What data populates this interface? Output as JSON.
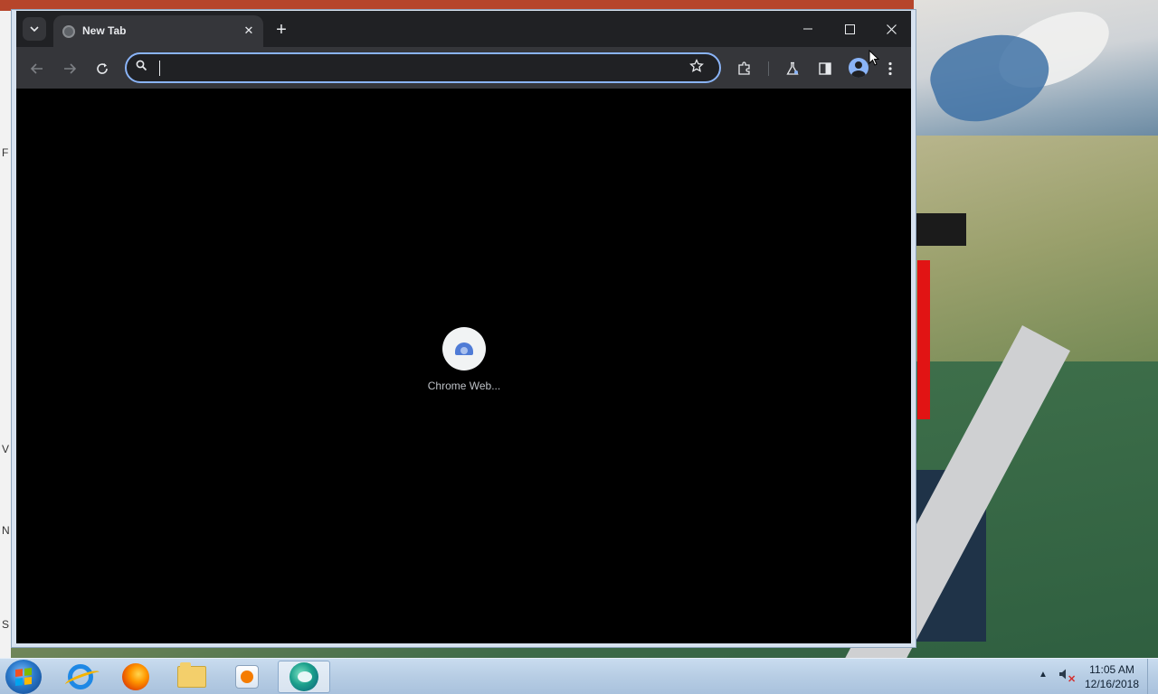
{
  "window": {
    "tab_title": "New Tab",
    "tab_close": "✕",
    "new_tab": "+",
    "minimize": "—",
    "maximize": "☐",
    "close": "✕"
  },
  "toolbar": {
    "omnibox_value": "",
    "omnibox_placeholder": ""
  },
  "content": {
    "shortcut_label": "Chrome Web..."
  },
  "taskbar": {
    "time": "11:05 AM",
    "date": "12/16/2018"
  },
  "desktop_edge_letters": [
    "F",
    "V",
    "N",
    "S"
  ],
  "icons": {
    "tab_search": "chevron-down-icon",
    "back": "arrow-left-icon",
    "forward": "arrow-right-icon",
    "reload": "reload-icon",
    "search": "search-icon",
    "bookmark": "star-icon",
    "extensions": "puzzle-icon",
    "labs": "flask-icon",
    "side_panel": "side-panel-icon",
    "profile": "profile-icon",
    "menu": "kebab-menu-icon"
  },
  "colors": {
    "accent": "#8ab4f8",
    "tab_bg": "#35363a",
    "chrome_bg": "#202124",
    "content_bg": "#000000"
  }
}
